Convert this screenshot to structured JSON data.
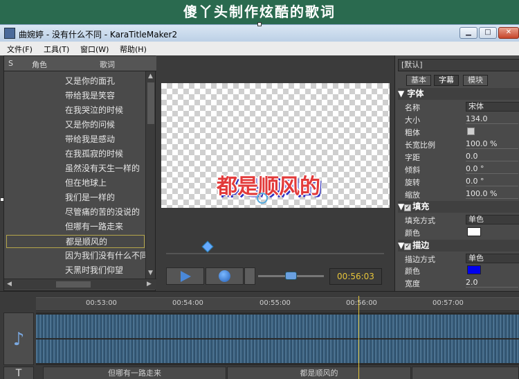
{
  "banner": {
    "text": "傻丫头制作炫酷的歌词"
  },
  "window": {
    "title": "曲婉婷 - 没有什么不同 - KaraTitleMaker2",
    "minimize": "▁",
    "maximize": "□",
    "close": "✕"
  },
  "menu": [
    "文件(F)",
    "工具(T)",
    "窗口(W)",
    "帮助(H)"
  ],
  "lyric_panel": {
    "columns": [
      "S",
      "角色",
      "歌词"
    ],
    "rows": [
      "又是你的面孔",
      "带给我是笑容",
      "在我哭泣的时候",
      "又是你的问候",
      "带给我是感动",
      "在我孤寂的时候",
      "虽然没有天生一样的",
      "但在地球上",
      "我们是一样的",
      "尽管痛的苦的没说的",
      "但哪有一路走来",
      "都是顺风的",
      "因为我们没有什么不同",
      "天黑时我们仰望"
    ],
    "selected_index": 11
  },
  "preview": {
    "text": "都是顺风的"
  },
  "player": {
    "time": "00:56:03"
  },
  "props": {
    "preset": "[默认]",
    "tabs": [
      "基本",
      "字幕",
      "模块"
    ],
    "active_tab": 1,
    "font_section": "字体",
    "font_rows": [
      {
        "label": "名称",
        "value": "宋体"
      },
      {
        "label": "大小",
        "value": "134.0"
      },
      {
        "label": "粗体",
        "value": ""
      },
      {
        "label": "长宽比例",
        "value": "100.0 %"
      },
      {
        "label": "字距",
        "value": "0.0"
      },
      {
        "label": "倾斜",
        "value": "0.0 °"
      },
      {
        "label": "旋转",
        "value": "0.0 °"
      },
      {
        "label": "缩放",
        "value": "100.0 %"
      }
    ],
    "fill_section": "填充",
    "fill_rows": [
      {
        "label": "填充方式",
        "value": "单色"
      },
      {
        "label": "颜色",
        "value": ""
      }
    ],
    "fill_color": "#ffffff",
    "stroke_section": "描边",
    "stroke_rows": [
      {
        "label": "描边方式",
        "value": "单色"
      },
      {
        "label": "颜色",
        "value": ""
      },
      {
        "label": "宽度",
        "value": "2.0"
      }
    ],
    "stroke_color": "#0000ee"
  },
  "timeline": {
    "ticks": [
      "00:53:00",
      "00:54:00",
      "00:55:00",
      "00:56:00",
      "00:57:00"
    ],
    "segments": [
      "但哪有一路走来",
      "都是顺风的"
    ],
    "audio_icon": "♪",
    "text_icon": "T"
  },
  "colors": {
    "accent": "#e6c43a",
    "preview_text": "#e23a3a",
    "banner_bg": "#2a6a4f"
  }
}
